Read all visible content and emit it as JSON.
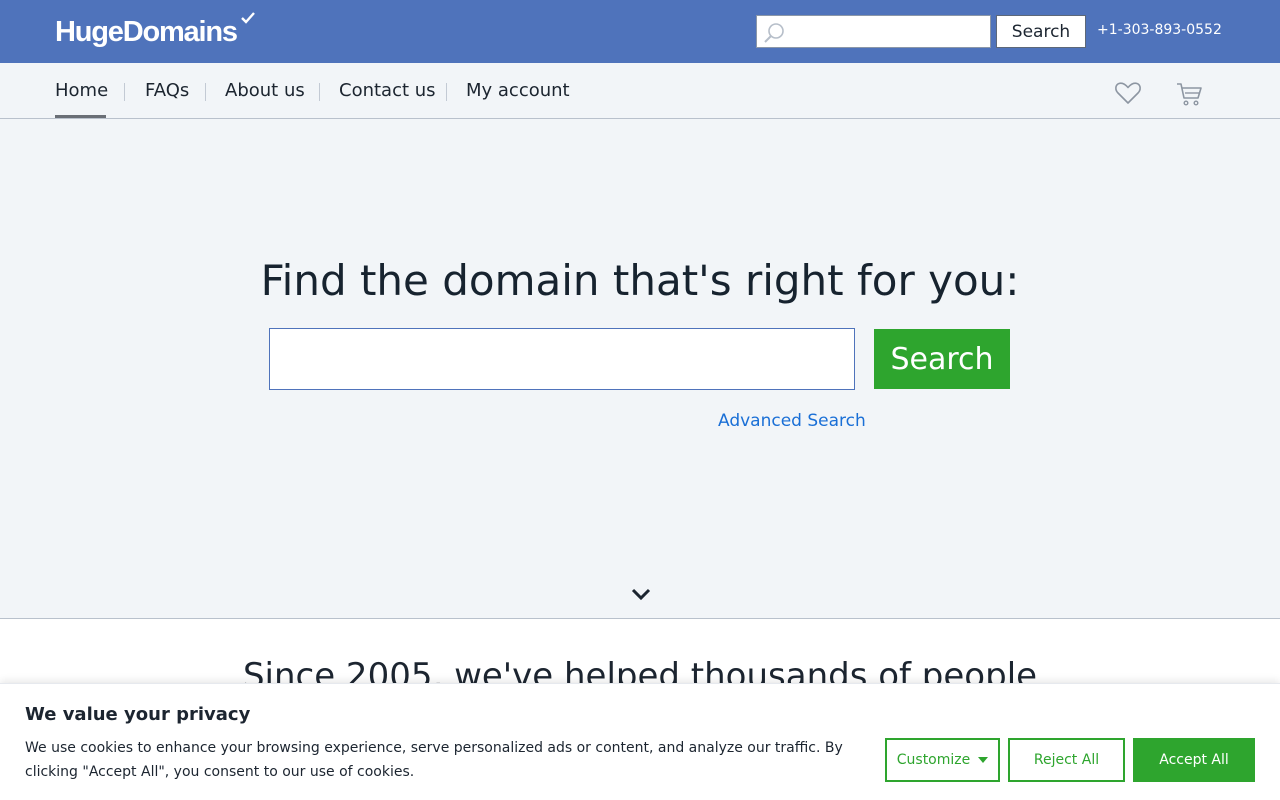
{
  "header": {
    "logo_text": "HugeDomains",
    "search_placeholder": "",
    "search_button": "Search",
    "phone": "+1-303-893-0552",
    "brand_color": "#4f73bb"
  },
  "nav": {
    "items": [
      {
        "label": "Home",
        "active": true
      },
      {
        "label": "FAQs"
      },
      {
        "label": "About us"
      },
      {
        "label": "Contact us"
      },
      {
        "label": "My account"
      }
    ],
    "icons": [
      "heart-icon",
      "cart-icon"
    ]
  },
  "hero": {
    "title": "Find the domain that's right for you:",
    "input_value": "",
    "search_button": "Search",
    "advanced_link": "Advanced Search",
    "accent_color": "#2ea52e"
  },
  "lower": {
    "title": "Since 2005, we've helped thousands of people"
  },
  "cookie": {
    "title": "We value your privacy",
    "text": "We use cookies to enhance your browsing experience, serve personalized ads or content, and analyze our traffic. By clicking \"Accept All\", you consent to our use of cookies.",
    "customize": "Customize",
    "reject": "Reject All",
    "accept": "Accept All"
  }
}
